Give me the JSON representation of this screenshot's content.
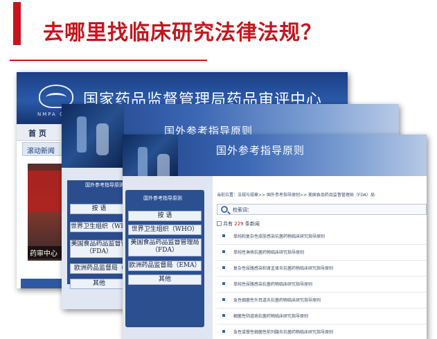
{
  "slide": {
    "title": "去哪里找临床研究法律法规？",
    "accent_color": "#c4161c"
  },
  "cde_homepage": {
    "site_name": "国家药品监督管理局药品审评中心",
    "logo_text": "NMPA C",
    "nav_home": "首  页",
    "news_label": "滚动新闻",
    "photo_caption": "药审中心"
  },
  "guideline_page_back": {
    "banner_title": "国外参考指导原则",
    "sidebar_heading": "国外参考指导原则",
    "buttons": [
      "按    语",
      "世界卫生组织（WHO",
      "美国食品药品监督管\n（FDA）",
      "欧洲药品监督局（",
      "其他"
    ]
  },
  "guideline_page_front": {
    "banner_title": "国外参考指导原则",
    "sidebar_heading": "国外参考指导原则",
    "buttons": [
      "按    语",
      "世界卫生组织（WHO）",
      "美国食品药品监督管理局（FDA）",
      "欧洲药品监督局（EMA）",
      "其他"
    ],
    "breadcrumb": "当前位置：法规与规章>> 国外参考指导原则>> 美国食品药品监督管理局（FDA）局",
    "search_label": "检索词：",
    "count_prefix": "共有",
    "count_value": "229",
    "count_suffix": "条新闻",
    "items": [
      "单纯和复杂性皮肤感染抗菌药物临床研究指导原则",
      "单纯性淋病抗菌药物临床研究指导原则",
      "复杂性尿路感染和肾盂肾炎抗菌药物临床研究指导原则",
      "单纯性尿路感染抗菌药物临床研究指导原则",
      "急性细菌性外耳道炎抗菌药物临床研究指导原则",
      "细菌性阴道病抗菌药物临床研究指导原则",
      "急性或慢性细菌性前列腺炎抗菌药物临床研究指导原则"
    ]
  }
}
